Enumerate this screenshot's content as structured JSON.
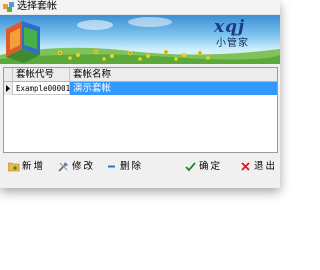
{
  "window": {
    "title": "选择套帐",
    "logo_text": "xqj",
    "brand": "小管家"
  },
  "grid": {
    "columns": [
      "套帐代号",
      "套帐名称"
    ],
    "rows": [
      {
        "code": "Example00001",
        "name": "演示套帐",
        "selected": true
      }
    ]
  },
  "buttons": {
    "add": "新增",
    "edit": "修改",
    "delete": "删除",
    "ok": "确定",
    "exit": "退出"
  },
  "colors": {
    "selection": "#3399ff",
    "banner_sky": "#3d8fd3",
    "grass": "#5aa93a"
  },
  "icons": {
    "title": "app-cubes-icon",
    "row_indicator": "current-row-arrow-icon",
    "add": "add-folder-icon",
    "edit": "edit-tools-icon",
    "delete": "minus-icon",
    "ok": "checkmark-icon",
    "exit": "red-x-icon"
  }
}
